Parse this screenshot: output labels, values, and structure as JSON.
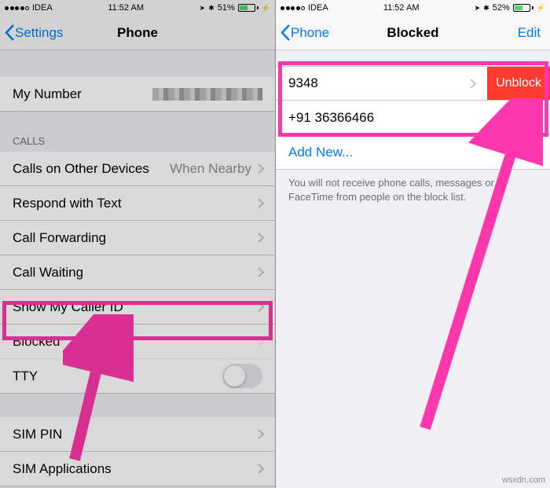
{
  "status": {
    "carrier": "IDEA",
    "time": "11:52 AM",
    "battery_left": "51%",
    "battery_right": "52%",
    "location_glyph": "➤",
    "bt_glyph": "✱",
    "charge_glyph": "⚡"
  },
  "left": {
    "back": "Settings",
    "title": "Phone",
    "my_number_label": "My Number",
    "calls_header": "CALLS",
    "rows": {
      "calls_other": "Calls on Other Devices",
      "calls_other_value": "When Nearby",
      "respond": "Respond with Text",
      "forwarding": "Call Forwarding",
      "waiting": "Call Waiting",
      "caller_id": "Show My Caller ID",
      "blocked": "Blocked",
      "tty": "TTY",
      "sim_pin": "SIM PIN",
      "sim_apps": "SIM Applications"
    }
  },
  "right": {
    "back": "Phone",
    "title": "Blocked",
    "edit": "Edit",
    "num1": "9348",
    "num2": "+91 36366466",
    "unblock": "Unblock",
    "add_new": "Add New...",
    "note": "You will not receive phone calls, messages or FaceTime from people on the block list."
  },
  "watermark": "wsxdn.com"
}
